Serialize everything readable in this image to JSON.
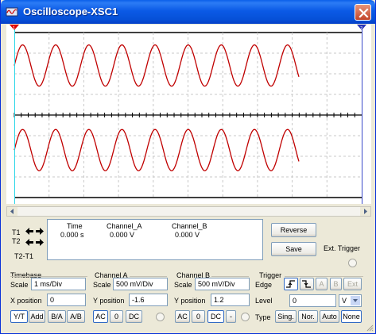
{
  "window": {
    "title": "Oscilloscope-XSC1"
  },
  "colors": {
    "trace": "#c00000",
    "titlebar": "#0b5ae6",
    "grid": "#c8c8c8",
    "cursor_t1": "#2ad6e8",
    "cursor_t2": "#3b49c9"
  },
  "icons": {
    "app": "oscilloscope-icon",
    "close": "close-icon",
    "t1_cursor": "red-triangle-cursor",
    "t2_cursor": "blue-triangle-cursor"
  },
  "cursors": {
    "t1_label": "T1",
    "t2_label": "T2",
    "diff_label": "T2-T1"
  },
  "readout": {
    "headers": {
      "time": "Time",
      "channel_a": "Channel_A",
      "channel_b": "Channel_B"
    },
    "row": {
      "time": "0.000 s",
      "channel_a": "0.000 V",
      "channel_b": "0.000 V"
    }
  },
  "buttons": {
    "reverse": "Reverse",
    "save": "Save"
  },
  "ext_trigger_label": "Ext. Trigger",
  "timebase": {
    "title": "Timebase",
    "scale_label": "Scale",
    "scale_value": "1 ms/Div",
    "xpos_label": "X position",
    "xpos_value": "0",
    "modes": [
      "Y/T",
      "Add",
      "B/A",
      "A/B"
    ],
    "active_mode": "Y/T"
  },
  "channel_a": {
    "title": "Channel A",
    "scale_label": "Scale",
    "scale_value": "500 mV/Div",
    "ypos_label": "Y position",
    "ypos_value": "-1.6",
    "coupling": [
      "AC",
      "0",
      "DC"
    ],
    "active_coupling": "AC"
  },
  "channel_b": {
    "title": "Channel B",
    "scale_label": "Scale",
    "scale_value": "500 mV/Div",
    "ypos_label": "Y position",
    "ypos_value": "1.2",
    "coupling": [
      "AC",
      "0",
      "DC",
      "-"
    ],
    "active_coupling": "DC"
  },
  "trigger": {
    "title": "Trigger",
    "edge_label": "Edge",
    "sources": [
      "A",
      "B",
      "Ext"
    ],
    "level_label": "Level",
    "level_value": "0",
    "level_unit": "V",
    "type_label": "Type",
    "types": [
      "Sing.",
      "Nor.",
      "Auto",
      "None"
    ],
    "active_type": "None"
  },
  "traces": {
    "channel_a": {
      "cycles_shown": 8.6,
      "amplitude_div": 1
    },
    "channel_b": {
      "cycles_shown": 8.6,
      "amplitude_div": 1
    }
  }
}
